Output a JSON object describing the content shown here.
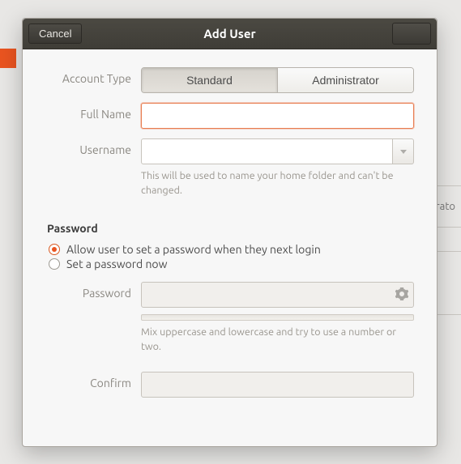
{
  "titlebar": {
    "cancel_label": "Cancel",
    "title": "Add User"
  },
  "account": {
    "type_label": "Account Type",
    "type_options": {
      "standard": "Standard",
      "admin": "Administrator"
    },
    "type_selected": "standard",
    "fullname_label": "Full Name",
    "fullname_value": "",
    "username_label": "Username",
    "username_value": "",
    "username_help": "This will be used to name your home folder and can't be changed."
  },
  "password": {
    "section_title": "Password",
    "opt_later": "Allow user to set a password when they next login",
    "opt_now": "Set a password now",
    "selected": "later",
    "password_label": "Password",
    "password_value": "",
    "password_help": "Mix uppercase and lowercase and try to use a number or two.",
    "confirm_label": "Confirm",
    "confirm_value": ""
  },
  "bg": {
    "peek_text": "strato"
  },
  "colors": {
    "accent": "#e95420"
  }
}
